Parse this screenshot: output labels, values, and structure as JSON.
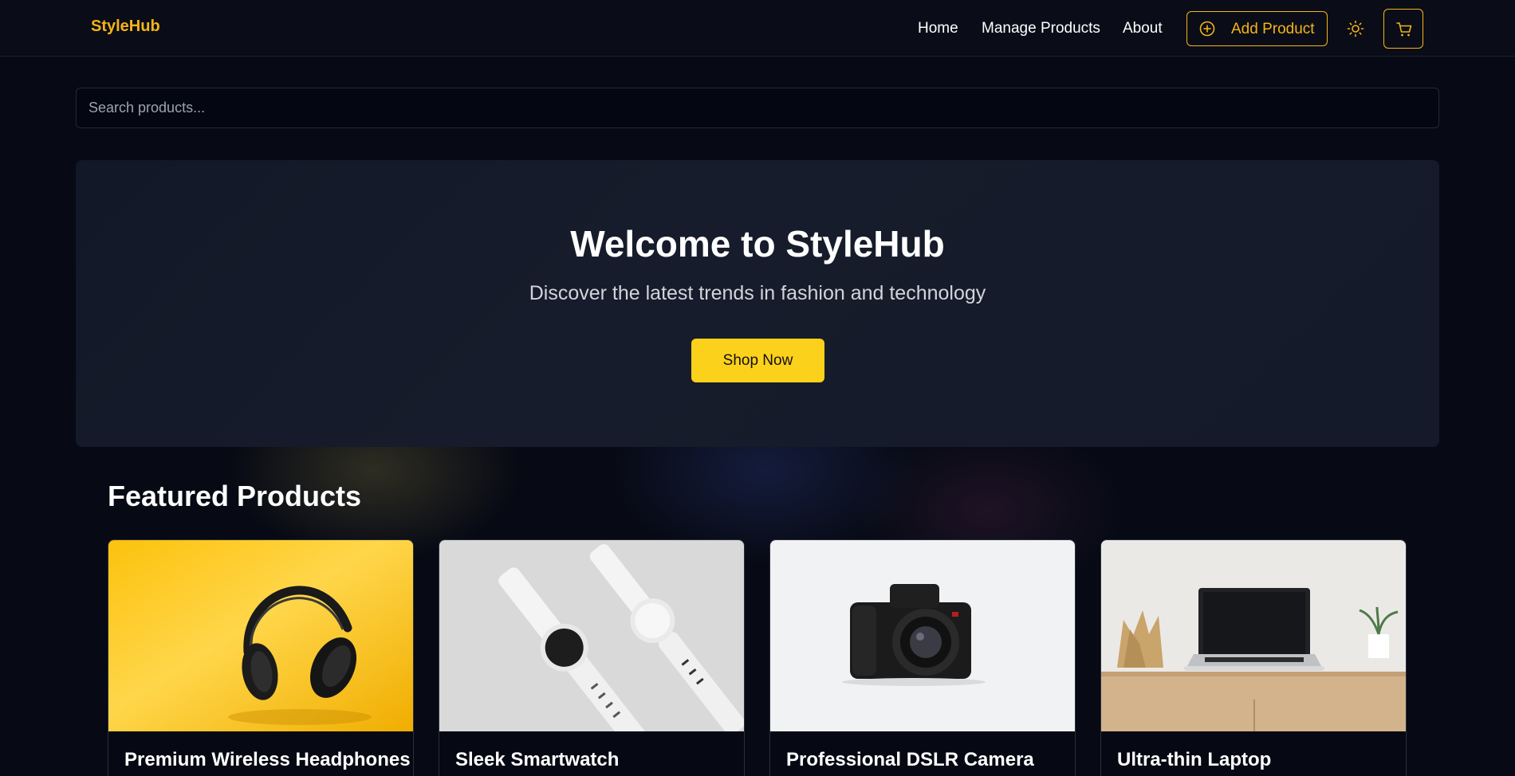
{
  "header": {
    "brand": "StyleHub",
    "nav": [
      {
        "label": "Home"
      },
      {
        "label": "Manage Products"
      },
      {
        "label": "About"
      }
    ],
    "add_product_label": "Add Product",
    "icons": {
      "add": "plus-circle-icon",
      "theme": "sun-icon",
      "cart": "cart-icon"
    },
    "accent_color": "#f4b416"
  },
  "search": {
    "placeholder": "Search products...",
    "value": ""
  },
  "hero": {
    "title": "Welcome to StyleHub",
    "subtitle": "Discover the latest trends in fashion and technology",
    "cta_label": "Shop Now",
    "cta_color": "#fcd11b"
  },
  "featured": {
    "title": "Featured Products",
    "products": [
      {
        "name": "Premium Wireless Headphones",
        "image": "headphones on yellow background"
      },
      {
        "name": "Sleek Smartwatch",
        "image": "white smartwatches on grey background"
      },
      {
        "name": "Professional DSLR Camera",
        "image": "black camera on white background"
      },
      {
        "name": "Ultra-thin Laptop",
        "image": "laptop on wooden desk"
      }
    ]
  }
}
